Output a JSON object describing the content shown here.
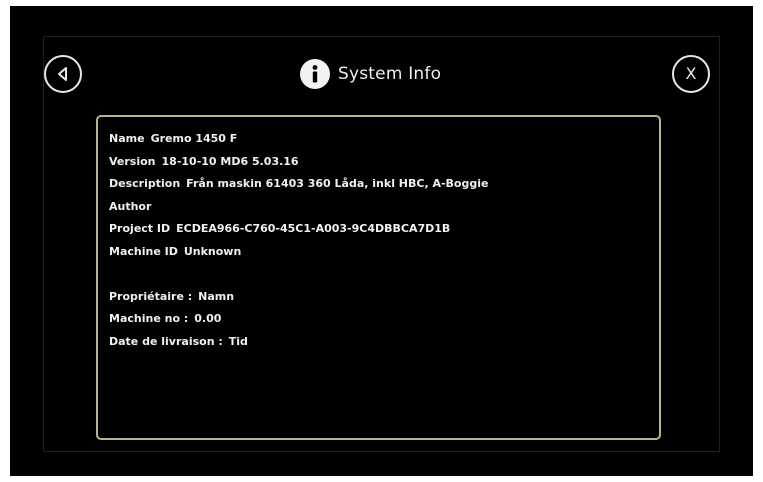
{
  "header": {
    "title": "System Info",
    "back_icon": "back-arrow-icon",
    "info_icon": "info-icon",
    "close_label": "X"
  },
  "details": {
    "name_label": "Name",
    "name_value": "Gremo 1450 F",
    "version_label": "Version",
    "version_value": "18-10-10 MD6 5.03.16",
    "description_label": "Description",
    "description_value": "Från maskin 61403 360 Låda, inkl HBC, A-Boggie",
    "author_label": "Author",
    "project_id_label": "Project ID",
    "project_id_value": "ECDEA966-C760-45C1-A003-9C4DBBCA7D1B",
    "machine_id_label": "Machine ID",
    "machine_id_value": "Unknown"
  },
  "owner": {
    "owner_label": "Propriétaire :",
    "owner_value": "Namn",
    "machine_no_label": "Machine no :",
    "machine_no_value": "0.00",
    "delivery_label": "Date de livraison :",
    "delivery_value": "Tid"
  },
  "colors": {
    "background": "#000000",
    "text": "#f0f0f0",
    "panel_border": "#bdb38e"
  }
}
